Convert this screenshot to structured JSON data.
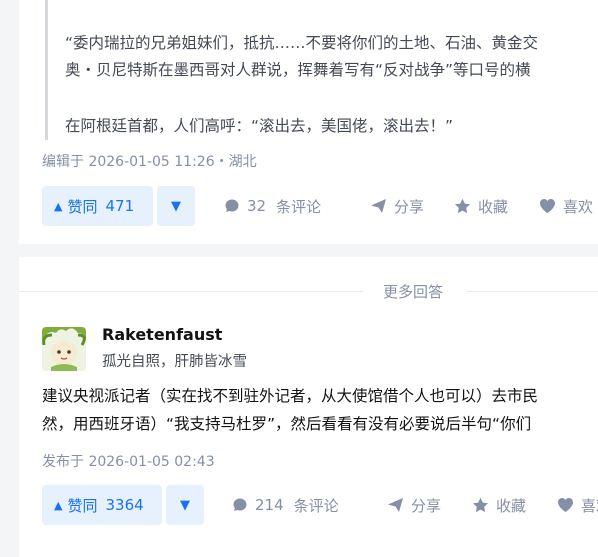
{
  "answer1": {
    "quote_lines": [
      "“委内瑞拉的兄弟姐妹们，抵抗……不要将你们的土地、石油、黄金交",
      "奥・贝尼特斯在墨西哥对人群说，挥舞着写有“反对战争”等口号的横",
      "在阿根廷首都，人们高呼：“滚出去，美国佬，滚出去！”"
    ],
    "meta": "编辑于 2026-01-05 11:26・湖北",
    "upvote_label": "赞同",
    "upvote_count": "471",
    "comments_count": "32",
    "comments_label": "条评论",
    "share_label": "分享",
    "collect_label": "收藏",
    "like_label": "喜欢"
  },
  "divider_label": "更多回答",
  "answer2": {
    "author_name": "Raketenfaust",
    "author_bio": "孤光自照，肝肺皆冰雪",
    "body_lines": [
      "建议央视派记者（实在找不到驻外记者，从大使馆借个人也可以）去市民",
      "然，用西班牙语）“我支持马杜罗”，然后看看有没有必要说后半句“你们"
    ],
    "meta": "发布于 2026-01-05 02:43",
    "upvote_label": "赞同",
    "upvote_count": "3364",
    "comments_count": "214",
    "comments_label": "条评论",
    "share_label": "分享",
    "collect_label": "收藏",
    "like_label": "喜欢"
  },
  "colors": {
    "accent": "#1772f6",
    "accent_bg": "#e7f0fd",
    "muted": "#8590a6",
    "page_bg": "#f4f5f7"
  }
}
